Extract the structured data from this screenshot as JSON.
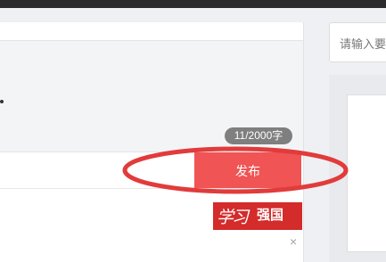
{
  "editor": {
    "char_count": "11/2000字",
    "publish_label": "发布"
  },
  "brand_badge": {
    "script_text": "学习",
    "name": "强国",
    "background_color": "#d42b2b"
  },
  "close": {
    "symbol": "×"
  },
  "search": {
    "placeholder": "请输入要"
  },
  "annotation": {
    "stroke_color": "#e23b3b"
  },
  "colors": {
    "accent": "#f05454",
    "counter_bg": "#7f7f7f",
    "topbar": "#2b2b2b"
  }
}
